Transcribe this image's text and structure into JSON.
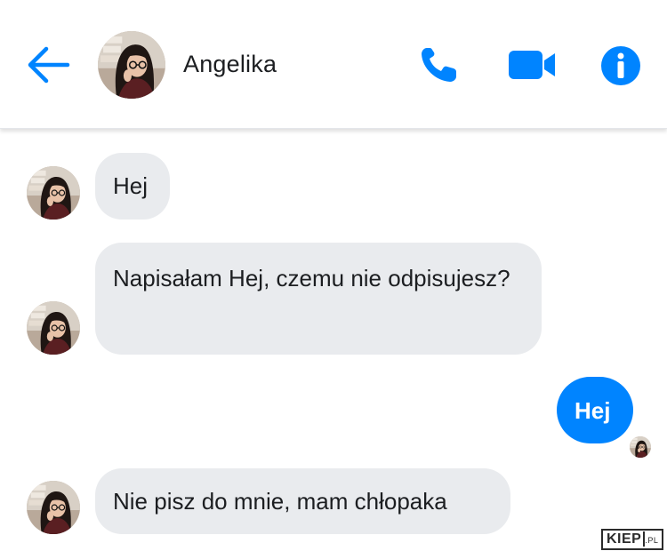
{
  "header": {
    "contact_name": "Angelika",
    "icons": {
      "back": "arrow-left-icon",
      "call": "phone-icon",
      "video": "video-camera-icon",
      "info": "info-icon"
    },
    "accent_color": "#0084ff"
  },
  "messages": [
    {
      "sender": "contact",
      "text": "Hej"
    },
    {
      "sender": "contact",
      "text": "Napisałam Hej, czemu nie odpisujesz?"
    },
    {
      "sender": "me",
      "text": "Hej"
    },
    {
      "sender": "contact",
      "text": "Nie pisz do mnie, mam chłopaka"
    }
  ],
  "watermark": {
    "text": "KIEP",
    "suffix": ".PL"
  },
  "colors": {
    "incoming_bubble": "#e9ebee",
    "outgoing_bubble": "#0084ff",
    "text": "#1c1e21"
  }
}
